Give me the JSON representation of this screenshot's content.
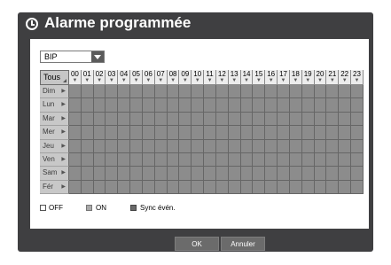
{
  "dialog": {
    "title": "Alarme programmée"
  },
  "select": {
    "value": "BIP"
  },
  "grid": {
    "all_label": "Tous",
    "hours": [
      "00",
      "01",
      "02",
      "03",
      "04",
      "05",
      "06",
      "07",
      "08",
      "09",
      "10",
      "11",
      "12",
      "13",
      "14",
      "15",
      "16",
      "17",
      "18",
      "19",
      "20",
      "21",
      "22",
      "23"
    ],
    "days": [
      "Dim",
      "Lun",
      "Mar",
      "Mer",
      "Jeu",
      "Ven",
      "Sam",
      "Fér"
    ]
  },
  "legend": {
    "off": "OFF",
    "on": "ON",
    "sync": "Sync évén."
  },
  "buttons": {
    "ok": "OK",
    "cancel": "Annuler"
  },
  "colors": {
    "cell_on": "#8c8c8c",
    "cell_off": "#ffffff",
    "sync": "#6a6a6a",
    "dialog_bg": "#3f3f41"
  }
}
